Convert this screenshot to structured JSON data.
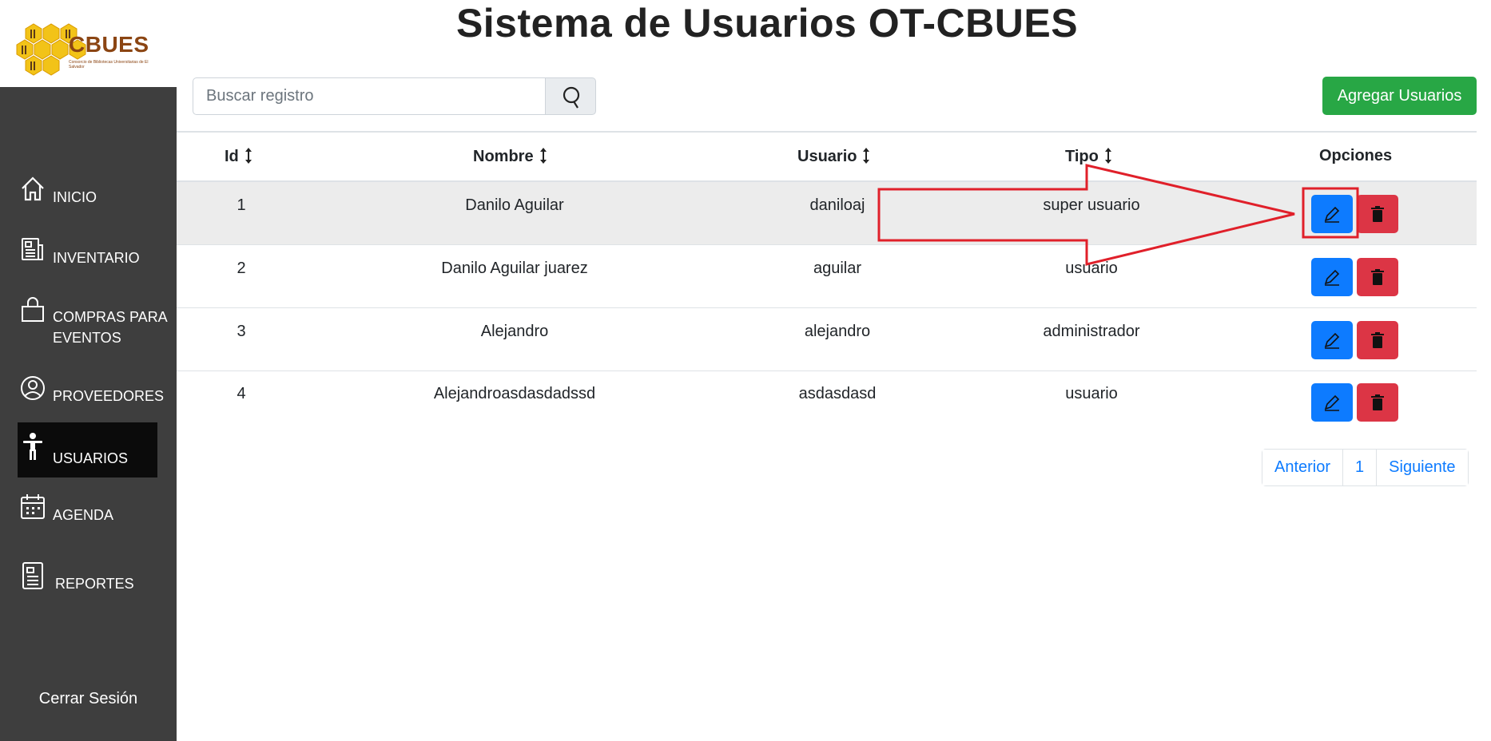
{
  "brand": {
    "logo_text": "CBUES",
    "logo_subtitle": "Consorcio de Bibliotecas Universitarias de El Salvador"
  },
  "sidebar": {
    "items": [
      {
        "label": "INICIO",
        "icon": "home-icon"
      },
      {
        "label": "INVENTARIO",
        "icon": "newspaper-icon"
      },
      {
        "label": "COMPRAS PARA EVENTOS",
        "icon": "shopping-bag-icon"
      },
      {
        "label": "PROVEEDORES",
        "icon": "user-circle-icon"
      },
      {
        "label": "USUARIOS",
        "icon": "person-icon",
        "active": true
      },
      {
        "label": "AGENDA",
        "icon": "calendar-icon"
      },
      {
        "label": "REPORTES",
        "icon": "report-icon"
      }
    ],
    "logout_label": "Cerrar Sesión"
  },
  "header": {
    "title": "Sistema de Usuarios OT-CBUES"
  },
  "search": {
    "placeholder": "Buscar registro",
    "value": ""
  },
  "toolbar": {
    "add_label": "Agregar Usuarios"
  },
  "table": {
    "columns": [
      "Id",
      "Nombre",
      "Usuario",
      "Tipo",
      "Opciones"
    ],
    "rows": [
      {
        "id": "1",
        "nombre": "Danilo Aguilar",
        "usuario": "daniloaj",
        "tipo": "super usuario"
      },
      {
        "id": "2",
        "nombre": "Danilo Aguilar juarez",
        "usuario": "aguilar",
        "tipo": "usuario"
      },
      {
        "id": "3",
        "nombre": "Alejandro",
        "usuario": "alejandro",
        "tipo": "administrador"
      },
      {
        "id": "4",
        "nombre": "Alejandroasdasdadssd",
        "usuario": "asdasdasd",
        "tipo": "usuario"
      }
    ]
  },
  "pagination": {
    "prev_label": "Anterior",
    "current_page": "1",
    "next_label": "Siguiente"
  },
  "colors": {
    "sidebar_bg": "#3e3e3e",
    "active_item_bg": "#0b0b0b",
    "add_button": "#28a745",
    "edit_button": "#0d7bff",
    "delete_button": "#dc3545",
    "annotation": "#e0202a"
  }
}
